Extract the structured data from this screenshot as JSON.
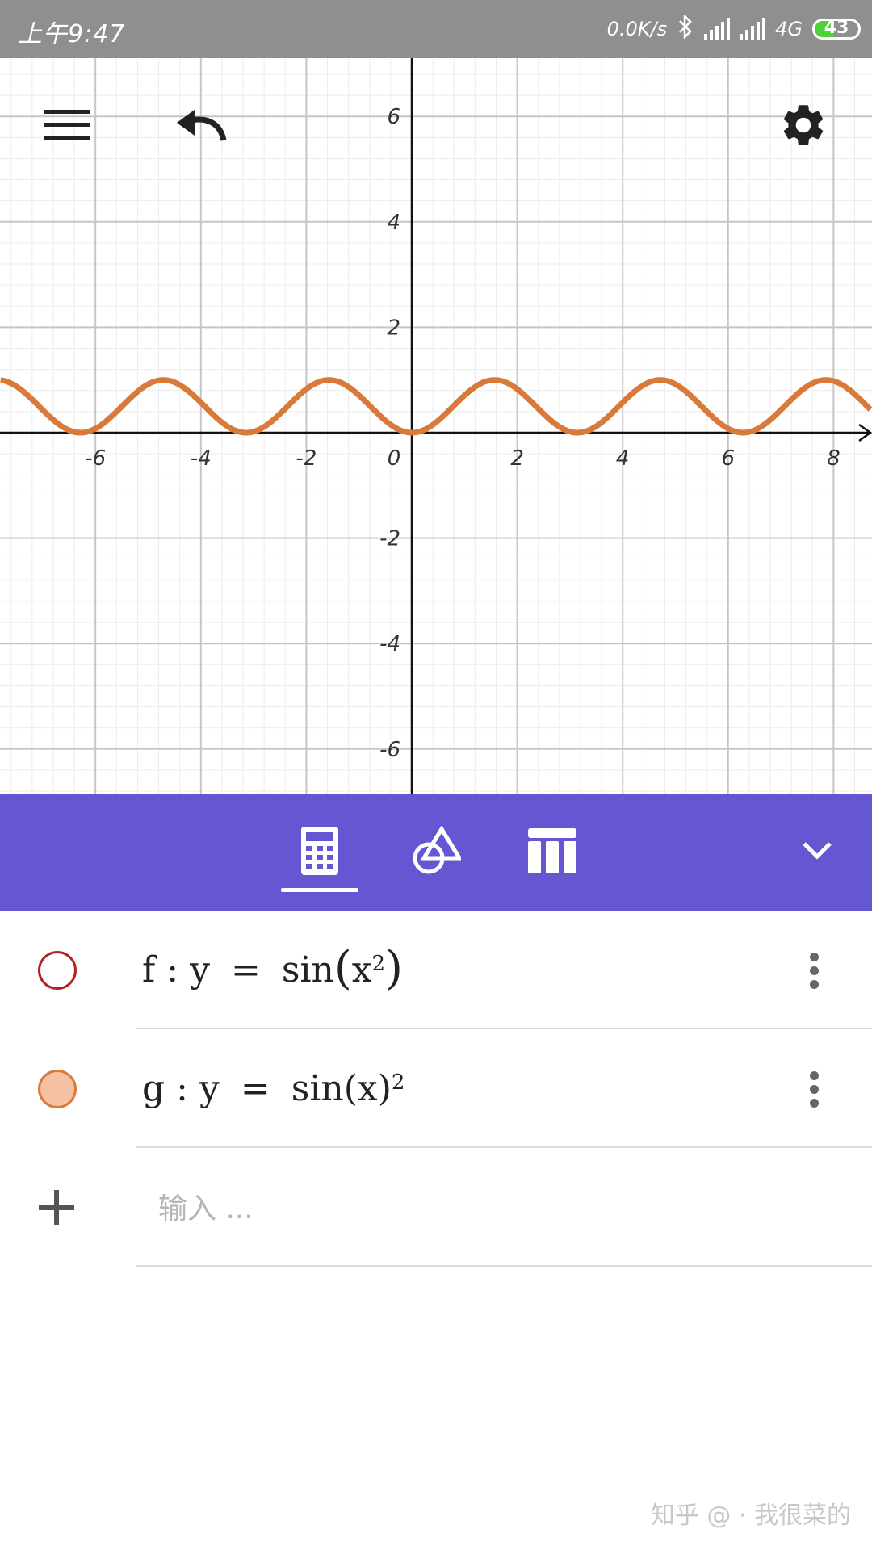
{
  "status_bar": {
    "time": "上午9:47",
    "network_speed": "0.0K/s",
    "network_type": "4G",
    "battery": "43",
    "battery_level": 0.43
  },
  "graph": {
    "x_ticks": [
      "-6",
      "-4",
      "-2",
      "0",
      "2",
      "4",
      "6",
      "8"
    ],
    "y_ticks": [
      "6",
      "4",
      "2",
      "-2",
      "-4",
      "-6"
    ],
    "curve_color": "#d9793a",
    "plotted_function": "sin(x)^2"
  },
  "chart_data": {
    "type": "line",
    "series": [
      {
        "name": "g",
        "function": "sin(x)^2",
        "color": "#d9793a"
      }
    ],
    "xlim": [
      -7.8,
      8.7
    ],
    "ylim": [
      -6.8,
      8.1
    ],
    "grid": true
  },
  "toolbar": {
    "tabs": [
      "algebra",
      "tools",
      "table"
    ],
    "active_tab": "algebra",
    "color": "#6557d2"
  },
  "algebra": {
    "items": [
      {
        "name": "f",
        "sep": ":",
        "lhs": "y",
        "eq": "=",
        "func": "sin",
        "arg": "x",
        "power": "2",
        "power_inside": true,
        "visible": false,
        "color": "#b22222"
      },
      {
        "name": "g",
        "sep": ":",
        "lhs": "y",
        "eq": "=",
        "func": "sin",
        "arg": "x",
        "power": "2",
        "power_inside": false,
        "visible": true,
        "color": "#d9793a"
      }
    ],
    "input_placeholder": "输入 ..."
  },
  "watermark": "知乎 @ · 我很菜的"
}
